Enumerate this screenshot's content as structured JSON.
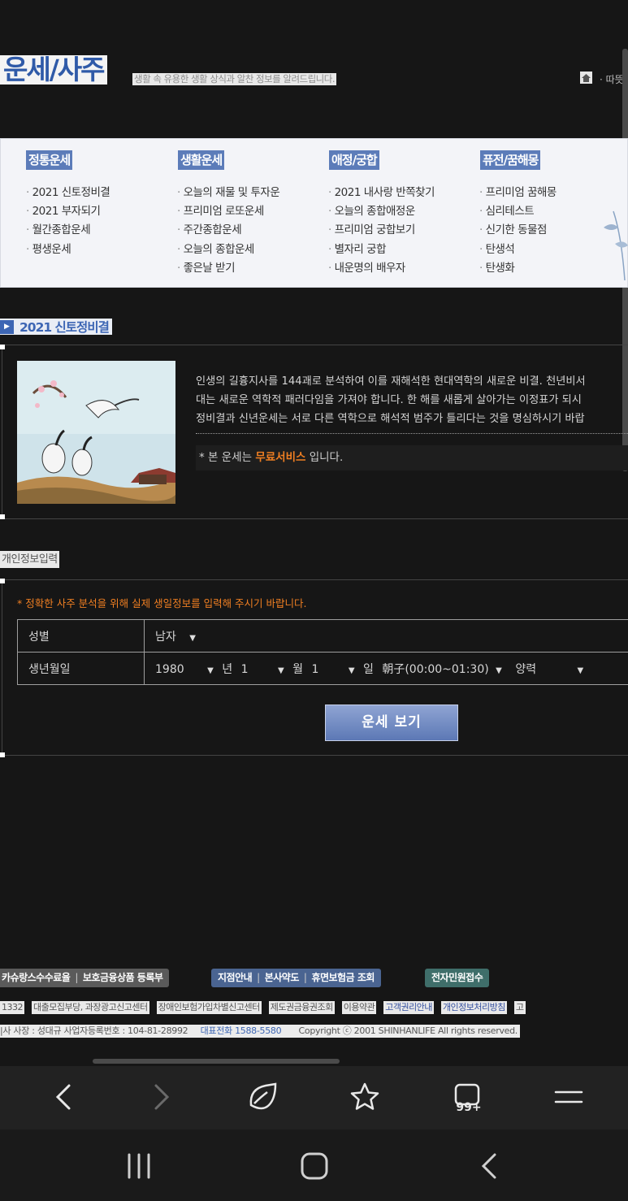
{
  "header": {
    "title": "운세/사주",
    "subtitle": "생활 속 유용한 생활 상식과 알찬 정보를 알려드립니다.",
    "home_icon": "home-icon",
    "right_link": "· 따뜻"
  },
  "menu": {
    "categories": [
      {
        "title": "정통운세",
        "items": [
          "2021 신토정비결",
          "2021 부자되기",
          "월간종합운세",
          "평생운세"
        ]
      },
      {
        "title": "생활운세",
        "items": [
          "오늘의 재물 및 투자운",
          "프리미엄 로또운세",
          "주간종합운세",
          "오늘의 종합운세",
          "좋은날 받기"
        ]
      },
      {
        "title": "애정/궁합",
        "items": [
          "2021 내사랑 반쪽찾기",
          "오늘의 종합애정운",
          "프리미엄 궁합보기",
          "별자리 궁합",
          "내운명의 배우자"
        ]
      },
      {
        "title": "퓨전/꿈해몽",
        "items": [
          "프리미엄 꿈해몽",
          "심리테스트",
          "신기한 동물점",
          "탄생석",
          "탄생화"
        ]
      }
    ]
  },
  "section1": {
    "title": "2021 신토정비결",
    "intro": [
      "인생의 길흉지사를 144괘로 분석하여 이를 재해석한 현대역학의 새로운 비결. 천년비서",
      "대는 새로운 역학적 패러다임을 가져야 합니다. 한 해를 새롭게 살아가는 이정표가 되시",
      "정비결과 신년운세는 서로 다른 역학으로 해석적 범주가 틀리다는 것을 명심하시기 바랍"
    ],
    "notice_prefix": "* 본 운세는",
    "notice_highlight": "무료서비스",
    "notice_suffix": "입니다."
  },
  "section2": {
    "title": "개인정보입력",
    "warning": "* 정확한 사주 분석을 위해 실제 생일정보를 입력해 주시기 바랍니다.",
    "gender_label": "성별",
    "gender_value": "남자",
    "birth_label": "생년월일",
    "year_value": "1980",
    "year_unit": "년",
    "month_value": "1",
    "month_unit": "월",
    "day_value": "1",
    "day_unit": "일",
    "hour_value": "朝子(00:00~01:30)",
    "calendar_value": "양력",
    "submit_label": "운세 보기"
  },
  "footer": {
    "group1": [
      "카슈랑스수수료율",
      "보호금융상품 등록부"
    ],
    "group2": [
      "지점안내",
      "본사약도",
      "휴면보험금 조회"
    ],
    "group3": "전자민원접수",
    "links": [
      "1332",
      "대출모집부당, 과장광고신고센터",
      "장애인보험가입차별신고센터",
      "제도권금융권조회",
      "이용약관",
      "고객권리안내",
      "개인정보처리방침",
      "고"
    ],
    "corp_prefix": "|사 사장 : 성대규   사업자등록번호 : 104-81-28992",
    "corp_phone": "대표전화 1588-5580",
    "copyright": "Copyright ⓒ 2001 SHINHANLIFE All rights reserved."
  },
  "browser": {
    "tabs_count": "99+"
  },
  "colors": {
    "accent_blue": "#5c7cb9",
    "highlight_orange": "#f07f22",
    "background": "#161616"
  }
}
